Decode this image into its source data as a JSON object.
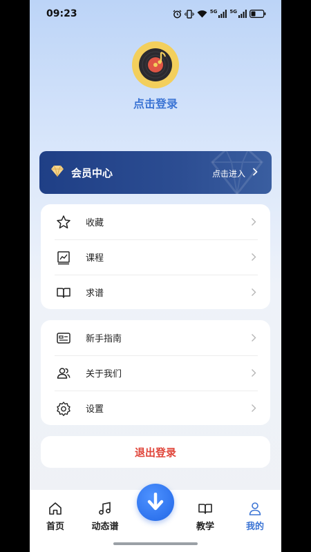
{
  "status_bar": {
    "time": "09:23",
    "battery_level": 0.35
  },
  "profile": {
    "login_prompt": "点击登录"
  },
  "vip": {
    "title": "会员中心",
    "enter_label": "点击进入"
  },
  "menu_group_1": [
    {
      "label": "收藏",
      "icon": "star-icon"
    },
    {
      "label": "课程",
      "icon": "chart-icon"
    },
    {
      "label": "求谱",
      "icon": "book-icon"
    }
  ],
  "menu_group_2": [
    {
      "label": "新手指南",
      "icon": "id-card-icon"
    },
    {
      "label": "关于我们",
      "icon": "users-icon"
    },
    {
      "label": "设置",
      "icon": "gear-icon"
    }
  ],
  "logout_label": "退出登录",
  "tabs": [
    {
      "label": "首页",
      "icon": "home-icon",
      "active": false
    },
    {
      "label": "动态谱",
      "icon": "music-note-icon",
      "active": false
    },
    {
      "label": "教学",
      "icon": "open-book-icon",
      "active": false
    },
    {
      "label": "我的",
      "icon": "person-icon",
      "active": true
    }
  ],
  "colors": {
    "accent": "#3b74d4",
    "logout": "#e0453a",
    "vip_bg": "#24468a",
    "fab": "#2f74ee",
    "avatar_ring": "#f3cf5c"
  }
}
